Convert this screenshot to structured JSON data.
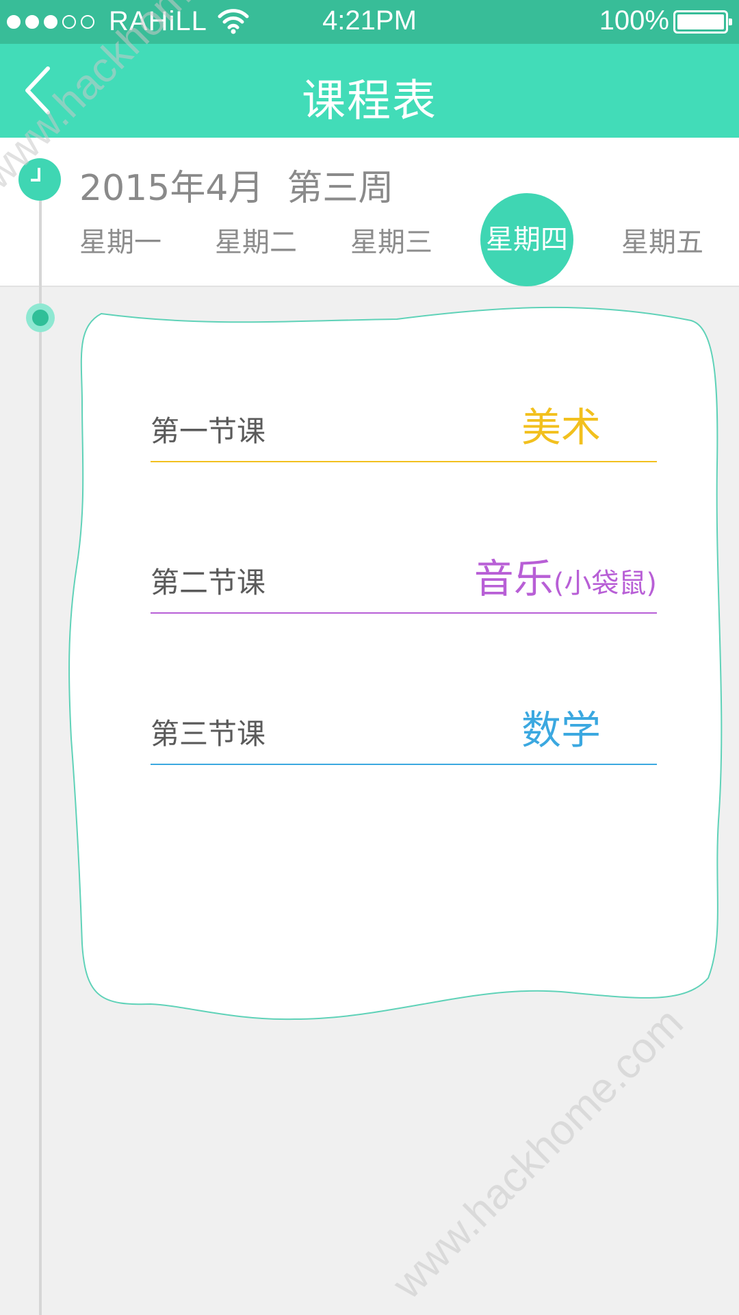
{
  "status_bar": {
    "carrier": "RAHiLL",
    "time": "4:21PM",
    "battery": "100%"
  },
  "nav": {
    "title": "课程表"
  },
  "header": {
    "month": "2015年4月",
    "week": "第三周"
  },
  "weekdays": [
    {
      "label": "星期一",
      "active": false
    },
    {
      "label": "星期二",
      "active": false
    },
    {
      "label": "星期三",
      "active": false
    },
    {
      "label": "星期四",
      "active": true
    },
    {
      "label": "星期五",
      "active": false
    }
  ],
  "lessons": [
    {
      "label": "第一节课",
      "subject": "美术",
      "note": "",
      "color": "#f2c01e"
    },
    {
      "label": "第二节课",
      "subject": "音乐",
      "note": "(小袋鼠)",
      "color": "#b85fd6"
    },
    {
      "label": "第三节课",
      "subject": "数学",
      "note": "",
      "color": "#3ba8e0"
    }
  ],
  "watermark": "www.hackhome.com",
  "colors": {
    "status_bar": "#38bd98",
    "nav_bar": "#42dcb8",
    "accent": "#3fd6b3"
  }
}
